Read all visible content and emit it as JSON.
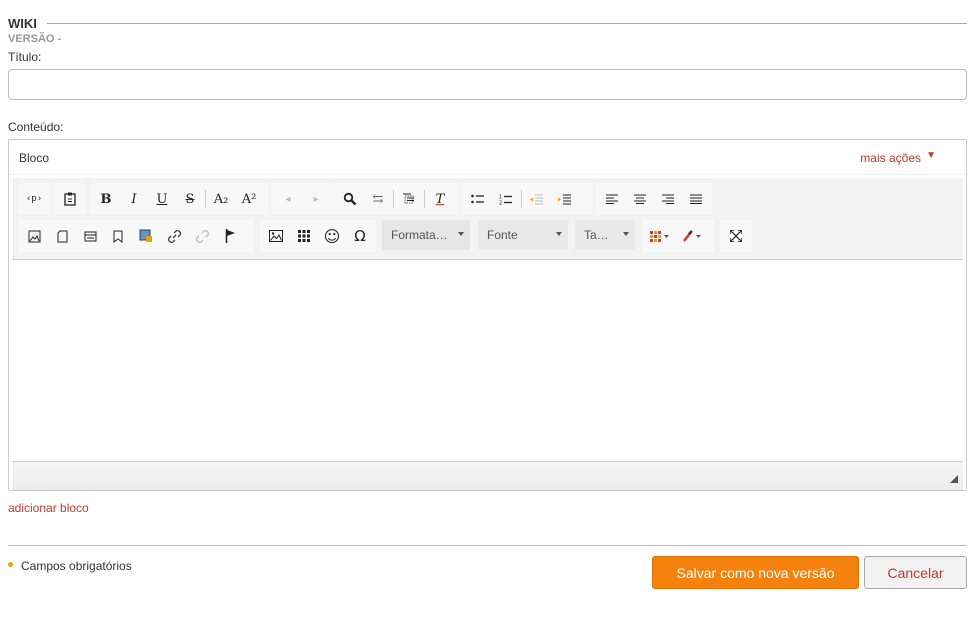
{
  "header": {
    "title": "WIKI",
    "version": "VERSÃO -"
  },
  "form": {
    "title_label": "Título:",
    "title_value": "",
    "content_label": "Conteúdo:"
  },
  "editor": {
    "block_label": "Bloco",
    "more_actions": "mais ações",
    "more_caret": "▼",
    "combos": {
      "format": "Formata…",
      "font": "Fonte",
      "size": "Ta…"
    },
    "icons": {
      "source": "‹p›",
      "paste_text": "📋",
      "bold": "B",
      "italic": "I",
      "underline": "U",
      "strike": "S",
      "subscript": "A₂",
      "superscript": "A²",
      "undo": "◂",
      "redo": "▸",
      "find": "⚲",
      "replace": "⇆",
      "select_all": "▤",
      "remove_format": "T",
      "bullet_list": "☰",
      "numbered_list": "☷",
      "outdent": "⇤",
      "indent": "⇥",
      "align_left": "≡",
      "align_center": "≡",
      "align_right": "≡",
      "justify": "≡",
      "special_char": "Ω",
      "smiley": "☺",
      "table": "▦",
      "fullscreen": "⛶"
    }
  },
  "add_block": "adicionar bloco",
  "footer": {
    "required": "Campos obrigatórios",
    "save": "Salvar como nova versão",
    "cancel": "Cancelar"
  },
  "colors": {
    "accent": "#f5820e",
    "link": "#c0392b",
    "required_dot": "#e8a400"
  }
}
